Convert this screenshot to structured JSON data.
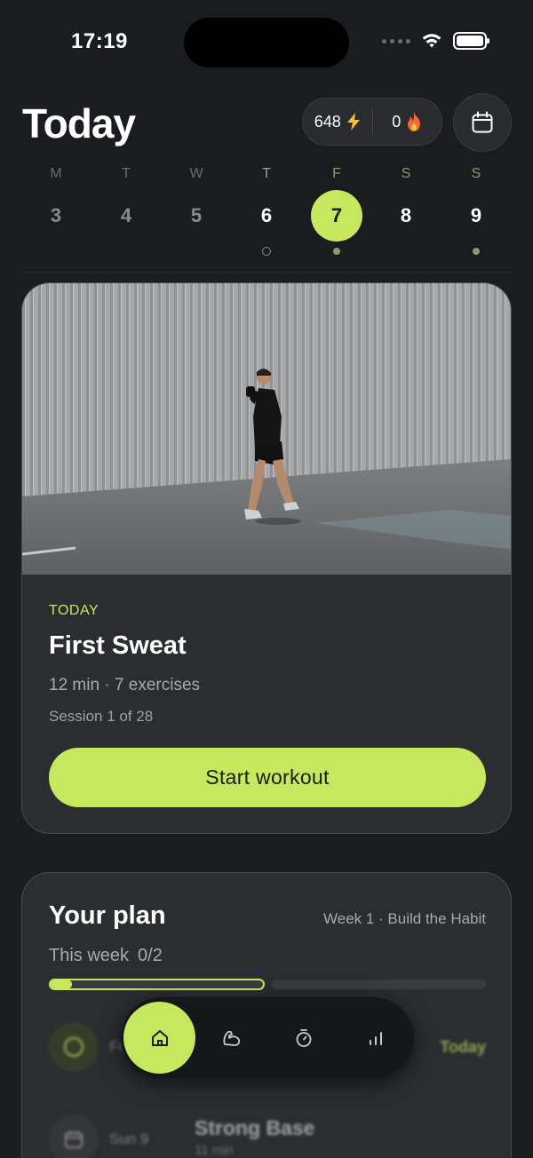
{
  "status_bar": {
    "time": "17:19"
  },
  "header": {
    "title": "Today",
    "energy": "648",
    "energy_icon": "lightning-icon",
    "streak": "0",
    "streak_icon": "fire-icon"
  },
  "week": {
    "days": [
      {
        "letter": "M",
        "number": "3"
      },
      {
        "letter": "T",
        "number": "4"
      },
      {
        "letter": "W",
        "number": "5"
      },
      {
        "letter": "T",
        "number": "6"
      },
      {
        "letter": "F",
        "number": "7"
      },
      {
        "letter": "S",
        "number": "8"
      },
      {
        "letter": "S",
        "number": "9"
      }
    ],
    "selected_index": 4
  },
  "workout": {
    "label": "TODAY",
    "title": "First Sweat",
    "meta": "12 min · 7 exercises",
    "session": "Session 1 of 28",
    "cta": "Start workout"
  },
  "plan": {
    "title": "Your plan",
    "week_label": "Week 1 · Build the Habit",
    "progress_label": "This week",
    "progress_count": "0/2",
    "progress_fraction": 0.1,
    "rows": [
      {
        "day": "Fri 7",
        "title": "",
        "sub": "",
        "tag": "Today"
      },
      {
        "day": "Sun 9",
        "title": "Strong Base",
        "sub": "11 min",
        "tag": ""
      }
    ]
  },
  "colors": {
    "accent": "#c6e85e",
    "background": "#1b1c1f",
    "card": "#2c2d31"
  },
  "nav": {
    "items": [
      "home-icon",
      "muscle-icon",
      "timer-icon",
      "stats-icon"
    ],
    "active": "home-icon"
  }
}
